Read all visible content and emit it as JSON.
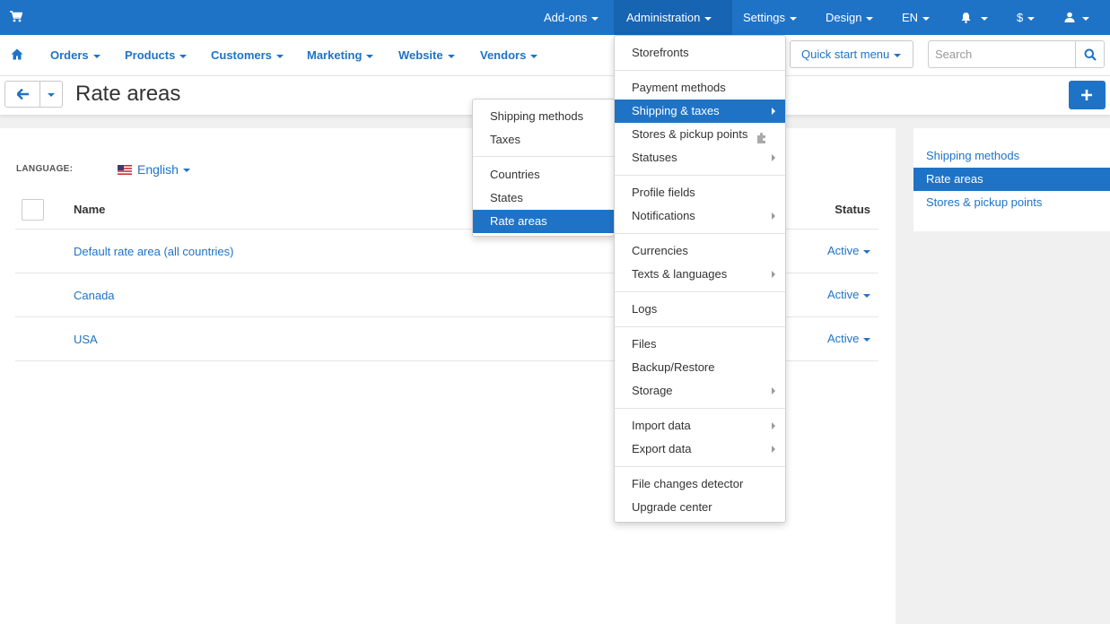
{
  "colors": {
    "brand": "#1f73c6",
    "brand_dark": "#1764b2"
  },
  "topbar": {
    "items": [
      {
        "label": "Add-ons"
      },
      {
        "label": "Administration"
      },
      {
        "label": "Settings"
      },
      {
        "label": "Design"
      },
      {
        "label": "EN"
      },
      {
        "label": "$"
      }
    ],
    "icons": [
      "cart-icon",
      "bell-icon",
      "user-icon"
    ]
  },
  "navbar": {
    "items": [
      {
        "label": "Orders"
      },
      {
        "label": "Products"
      },
      {
        "label": "Customers"
      },
      {
        "label": "Marketing"
      },
      {
        "label": "Website"
      },
      {
        "label": "Vendors"
      }
    ],
    "quick_start": "Quick start menu",
    "search_placeholder": "Search"
  },
  "page": {
    "title": "Rate areas",
    "language_label": "LANGUAGE:",
    "language_value": "English"
  },
  "table": {
    "columns": [
      "Name",
      "Status"
    ],
    "rows": [
      {
        "name": "Default rate area (all countries)",
        "status": "Active"
      },
      {
        "name": "Canada",
        "status": "Active"
      },
      {
        "name": "USA",
        "status": "Active"
      }
    ]
  },
  "sidebar": {
    "items": [
      {
        "label": "Shipping methods"
      },
      {
        "label": "Rate areas",
        "active": true
      },
      {
        "label": "Stores & pickup points"
      }
    ]
  },
  "admin_menu": {
    "items": [
      {
        "label": "Storefronts"
      },
      {
        "label": "Payment methods"
      },
      {
        "label": "Shipping & taxes",
        "highlighted": true
      },
      {
        "label": "Stores & pickup points"
      },
      {
        "label": "Statuses"
      },
      {
        "label": "Profile fields"
      },
      {
        "label": "Notifications"
      },
      {
        "label": "Currencies"
      },
      {
        "label": "Texts & languages"
      },
      {
        "label": "Logs"
      },
      {
        "label": "Files"
      },
      {
        "label": "Backup/Restore"
      },
      {
        "label": "Storage"
      },
      {
        "label": "Import data"
      },
      {
        "label": "Export data"
      },
      {
        "label": "File changes detector"
      },
      {
        "label": "Upgrade center"
      }
    ]
  },
  "shipping_submenu": {
    "items": [
      {
        "label": "Shipping methods"
      },
      {
        "label": "Taxes"
      },
      {
        "label": "Countries"
      },
      {
        "label": "States"
      },
      {
        "label": "Rate areas",
        "highlighted": true
      }
    ]
  }
}
